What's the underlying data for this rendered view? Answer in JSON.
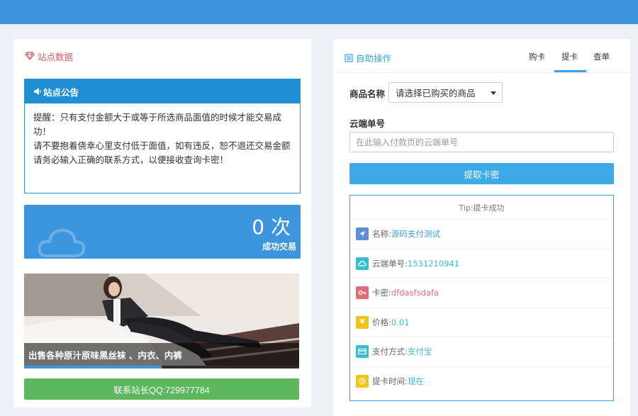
{
  "left": {
    "header": "站点数据",
    "notice": {
      "title": "站点公告",
      "line1": "提醒：只有支付金额大于或等于所选商品面值的时候才能交易成功！",
      "line2": "请不要抱着侥幸心里支付低于面值，如有违反，恕不退还交易金额",
      "line3": "请务必输入正确的联系方式，以便接收查询卡密！"
    },
    "stat": {
      "count": "0",
      "unit": "次",
      "label": "成功交易"
    },
    "banner": {
      "caption": "出售各种原汁原味黑丝袜 、内衣、内裤",
      "progress": 0.5
    },
    "contact_button": "联系站长QQ:729977784"
  },
  "right": {
    "header": "自助操作",
    "tabs": [
      "购卡",
      "提卡",
      "查单"
    ],
    "active_tab": "提卡",
    "product_label": "商品名称",
    "product_select": "请选择已购买的商品",
    "order_label": "云端单号",
    "order_placeholder": "在此输入付款页的云端单号",
    "submit_button": "提取卡密",
    "result": {
      "tip": "Tip:提卡成功",
      "rows": [
        {
          "label": "名称:",
          "value": "源码支付测试",
          "icon": "location-arrow-icon",
          "color": "#5b8fd8",
          "value_color": "#3aa0e0"
        },
        {
          "label": "云端单号:",
          "value": "1531210941",
          "icon": "cloud-icon",
          "color": "#3bbdd0",
          "value_color": "#3bbdd0"
        },
        {
          "label": "卡密:",
          "value": "dfdasfsdafa",
          "icon": "key-icon",
          "color": "#e06c75",
          "value_color": "#e06c75"
        },
        {
          "label": "价格:",
          "value": "0.01",
          "icon": "yen-icon",
          "color": "#f0c419",
          "value_color": "#3bbdd0"
        },
        {
          "label": "支付方式:",
          "value": "支付宝",
          "icon": "credit-card-icon",
          "color": "#3bbdd0",
          "value_color": "#3bbdd0"
        },
        {
          "label": "提卡时间:",
          "value": "现在",
          "icon": "clock-icon",
          "color": "#f0c419",
          "value_color": "#3bbdd0"
        }
      ]
    }
  },
  "colors": {
    "topbar": "#3e95dc",
    "accent": "#3aa0e0",
    "success": "#5cb85c",
    "danger": "#e0545b"
  }
}
